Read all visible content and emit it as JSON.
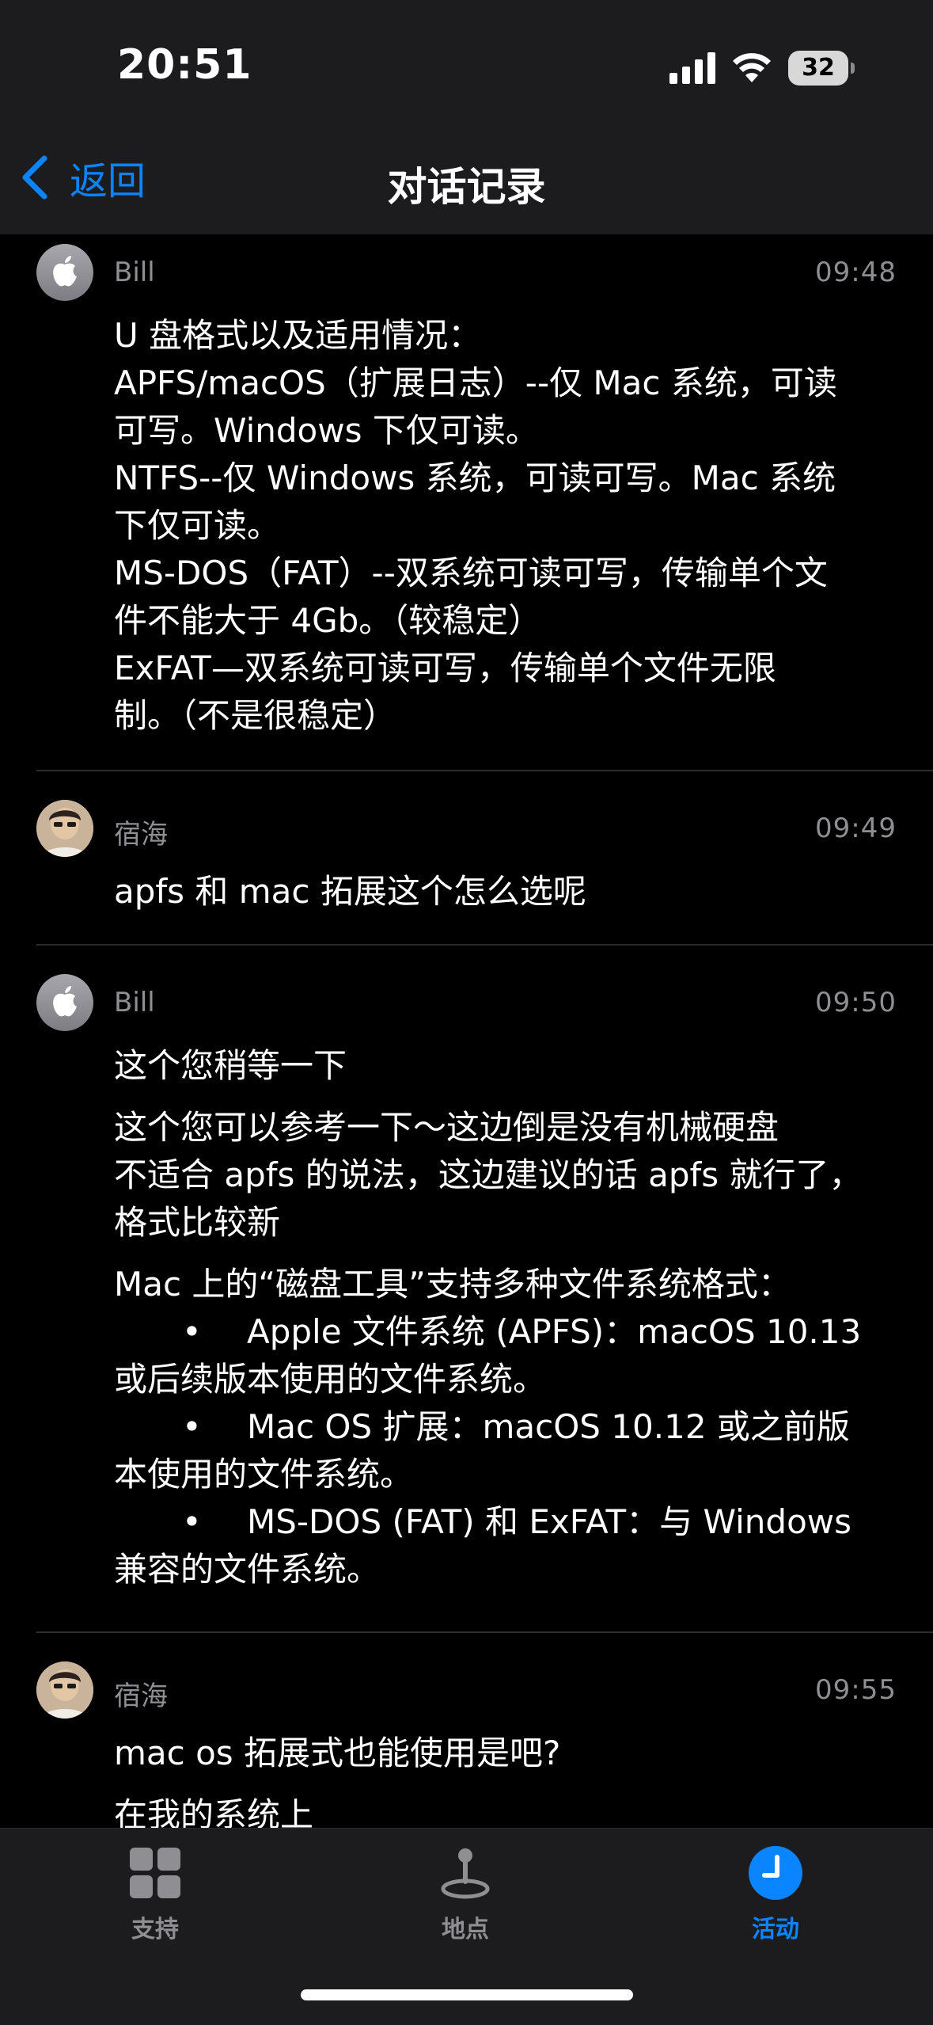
{
  "status_bar": {
    "time": "20:51",
    "battery": "32"
  },
  "nav": {
    "back_label": "返回",
    "title": "对话记录"
  },
  "messages": [
    {
      "sender": "Bill",
      "time": "09:48",
      "avatar": "apple-icon",
      "lines": [
        "U 盘格式以及适用情况：",
        "APFS/macOS（扩展日志）--仅 Mac 系统，可读",
        "可写。Windows 下仅可读。",
        "NTFS--仅 Windows 系统，可读可写。Mac 系统",
        "下仅可读。",
        "MS-DOS（FAT）--双系统可读可写，传输单个文",
        "件不能大于 4Gb。（较稳定）",
        "ExFAT—双系统可读可写，传输单个文件无限",
        "制。（不是很稳定）"
      ]
    },
    {
      "sender": "宿海",
      "time": "09:49",
      "avatar": "user-avatar",
      "lines": [
        "apfs 和 mac 拓展这个怎么选呢"
      ]
    },
    {
      "sender": "Bill",
      "time": "09:50",
      "avatar": "apple-icon",
      "p1": "这个您稍等一下",
      "p2": [
        "这个您可以参考一下～这边倒是没有机械硬盘",
        "不适合 apfs 的说法，这边建议的话 apfs 就行了，",
        "格式比较新"
      ],
      "p3_intro": "Mac 上的“磁盘工具”支持多种文件系统格式：",
      "bullet_symbol": "•",
      "bullets": [
        {
          "first": "Apple 文件系统 (APFS)：macOS 10.13",
          "second": "或后续版本使用的文件系统。"
        },
        {
          "first": "Mac OS 扩展：macOS 10.12 或之前版",
          "second": "本使用的文件系统。"
        },
        {
          "first": "MS-DOS (FAT) 和 ExFAT：与 Windows",
          "second": "兼容的文件系统。"
        }
      ]
    },
    {
      "sender": "宿海",
      "time": "09:55",
      "avatar": "user-avatar",
      "p1": "mac os 拓展式也能使用是吧?",
      "p2": "在我的系统上"
    }
  ],
  "tabs": [
    {
      "label": "支持",
      "icon": "grid-icon",
      "active": false
    },
    {
      "label": "地点",
      "icon": "location-pin-icon",
      "active": false
    },
    {
      "label": "活动",
      "icon": "clock-icon",
      "active": true
    }
  ],
  "colors": {
    "accent": "#0a84ff",
    "secondary_text": "#8e8e93",
    "bar_background": "#1c1c1e"
  }
}
